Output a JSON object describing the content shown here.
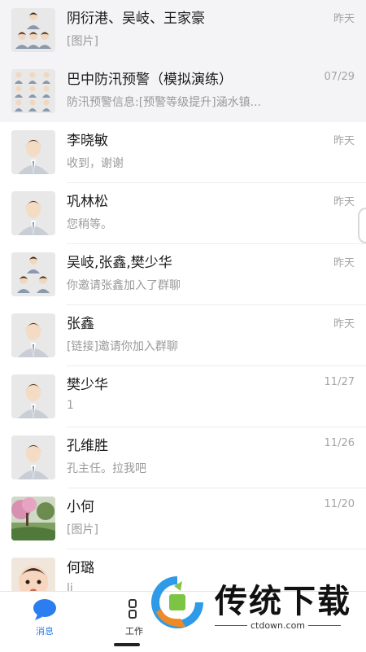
{
  "chats": [
    {
      "name": "阴衍港、吴岐、王家豪",
      "preview": "[图片]",
      "time": "昨天",
      "avatar": "group-4",
      "pinned": true
    },
    {
      "name": "巴中防汛预警（模拟演练）",
      "preview": "防汛预警信息:[预警等级提升]涵水镇...",
      "time": "07/29",
      "avatar": "group-9",
      "pinned": true
    },
    {
      "name": "李晓敏",
      "preview": "收到，谢谢",
      "time": "昨天",
      "avatar": "person",
      "pinned": false
    },
    {
      "name": "巩林松",
      "preview": "您稍等。",
      "time": "昨天",
      "avatar": "person",
      "pinned": false
    },
    {
      "name": "吴岐,张鑫,樊少华",
      "preview": "你邀请张鑫加入了群聊",
      "time": "昨天",
      "avatar": "group-3",
      "pinned": false
    },
    {
      "name": "张鑫",
      "preview": "[链接]邀请你加入群聊",
      "time": "昨天",
      "avatar": "person",
      "pinned": false
    },
    {
      "name": "樊少华",
      "preview": "1",
      "time": "11/27",
      "avatar": "person",
      "pinned": false
    },
    {
      "name": "孔维胜",
      "preview": "孔主任。拉我吧",
      "time": "11/26",
      "avatar": "person",
      "pinned": false
    },
    {
      "name": "小何",
      "preview": "[图片]",
      "time": "11/20",
      "avatar": "photo-landscape",
      "pinned": false
    },
    {
      "name": "何璐",
      "preview": "li",
      "time": "",
      "avatar": "photo-baby",
      "pinned": false
    }
  ],
  "tabbar": {
    "messages_label": "消息",
    "work_label": "工作",
    "accent": "#2a7ef0"
  },
  "watermark": {
    "text": "传统下载",
    "url": "ctdown.com"
  }
}
